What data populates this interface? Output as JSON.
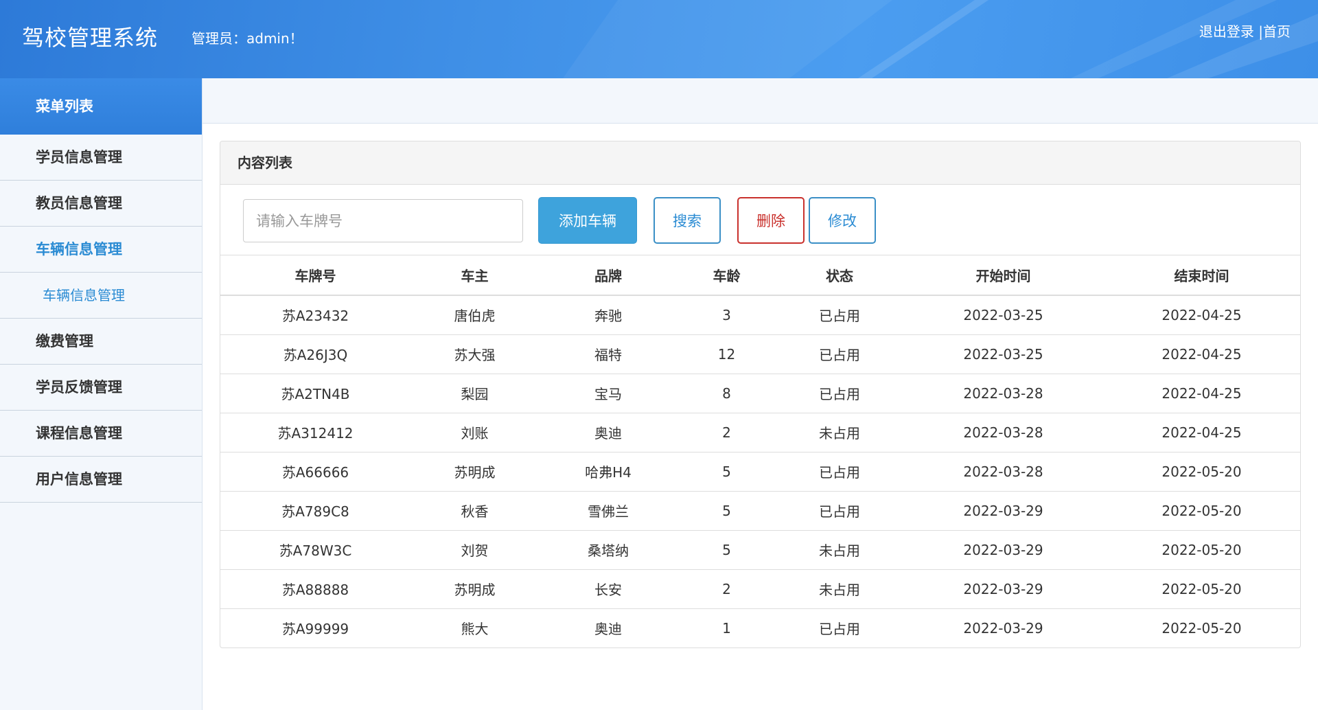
{
  "header": {
    "title": "驾校管理系统",
    "admin": "管理员：admin！",
    "logout": "退出登录",
    "separator": " |",
    "home": "首页"
  },
  "sidebar": {
    "head": "菜单列表",
    "items": [
      {
        "label": "学员信息管理"
      },
      {
        "label": "教员信息管理"
      },
      {
        "label": "车辆信息管理"
      },
      {
        "label": "车辆信息管理"
      },
      {
        "label": "缴费管理"
      },
      {
        "label": "学员反馈管理"
      },
      {
        "label": "课程信息管理"
      },
      {
        "label": "用户信息管理"
      }
    ]
  },
  "panel": {
    "title": "内容列表",
    "search_placeholder": "请输入车牌号",
    "add_label": "添加车辆",
    "search_label": "搜索",
    "delete_label": "删除",
    "edit_label": "修改"
  },
  "table": {
    "columns": [
      "车牌号",
      "车主",
      "品牌",
      "车龄",
      "状态",
      "开始时间",
      "结束时间"
    ],
    "rows": [
      [
        "苏A23432",
        "唐伯虎",
        "奔驰",
        "3",
        "已占用",
        "2022-03-25",
        "2022-04-25"
      ],
      [
        "苏A26J3Q",
        "苏大强",
        "福特",
        "12",
        "已占用",
        "2022-03-25",
        "2022-04-25"
      ],
      [
        "苏A2TN4B",
        "梨园",
        "宝马",
        "8",
        "已占用",
        "2022-03-28",
        "2022-04-25"
      ],
      [
        "苏A312412",
        "刘账",
        "奥迪",
        "2",
        "未占用",
        "2022-03-28",
        "2022-04-25"
      ],
      [
        "苏A66666",
        "苏明成",
        "哈弗H4",
        "5",
        "已占用",
        "2022-03-28",
        "2022-05-20"
      ],
      [
        "苏A789C8",
        "秋香",
        "雪佛兰",
        "5",
        "已占用",
        "2022-03-29",
        "2022-05-20"
      ],
      [
        "苏A78W3C",
        "刘贺",
        "桑塔纳",
        "5",
        "未占用",
        "2022-03-29",
        "2022-05-20"
      ],
      [
        "苏A88888",
        "苏明成",
        "长安",
        "2",
        "未占用",
        "2022-03-29",
        "2022-05-20"
      ],
      [
        "苏A99999",
        "熊大",
        "奥迪",
        "1",
        "已占用",
        "2022-03-29",
        "2022-05-20"
      ]
    ]
  },
  "colors": {
    "header": "#3f8fe6",
    "accent": "#2a8bd3",
    "primary_button": "#3ea3dc",
    "danger": "#c9302c"
  }
}
